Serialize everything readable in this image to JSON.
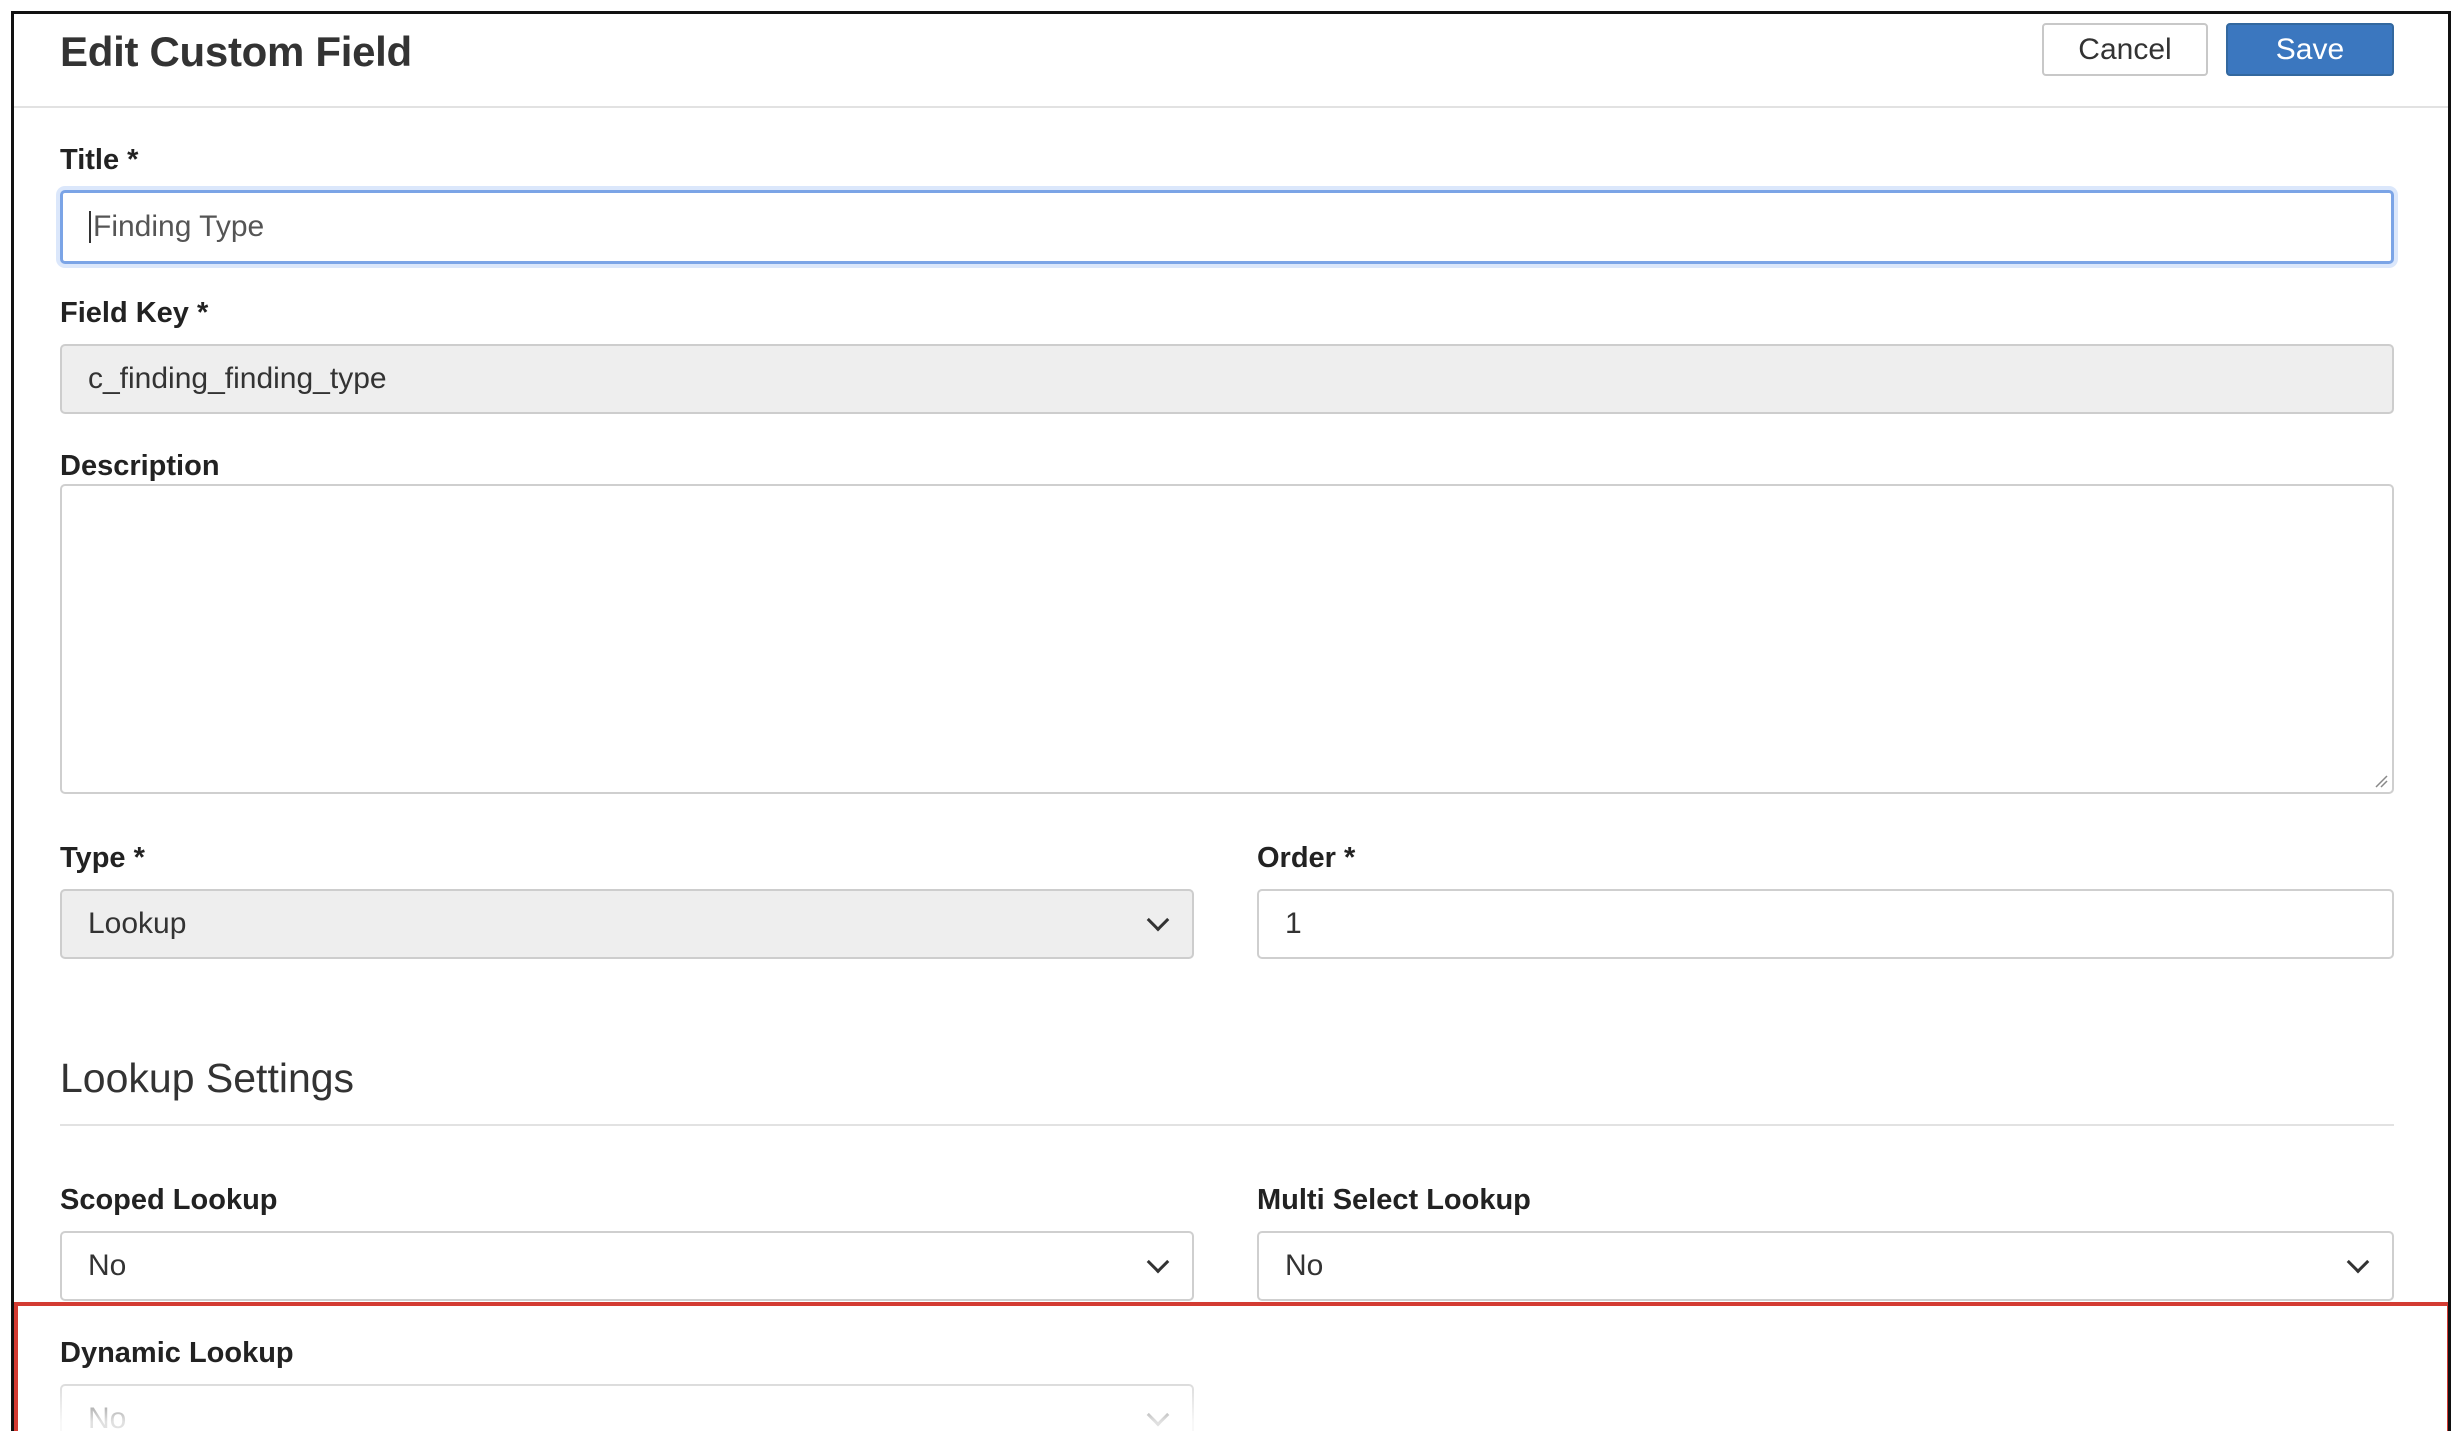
{
  "header": {
    "title": "Edit Custom Field",
    "cancel_label": "Cancel",
    "save_label": "Save"
  },
  "form": {
    "title_label": "Title *",
    "title_value": "Finding Type",
    "field_key_label": "Field Key *",
    "field_key_value": "c_finding_finding_type",
    "description_label": "Description",
    "description_value": "",
    "type_label": "Type *",
    "type_value": "Lookup",
    "order_label": "Order *",
    "order_value": "1"
  },
  "lookup_settings": {
    "section_title": "Lookup Settings",
    "scoped_label": "Scoped Lookup",
    "scoped_value": "No",
    "multi_select_label": "Multi Select Lookup",
    "multi_select_value": "No",
    "dynamic_label": "Dynamic Lookup",
    "dynamic_value": "No"
  },
  "colors": {
    "save_button": "#3b77bf",
    "highlight_border": "#d33b32",
    "focus_ring": "#7ba4e6"
  }
}
